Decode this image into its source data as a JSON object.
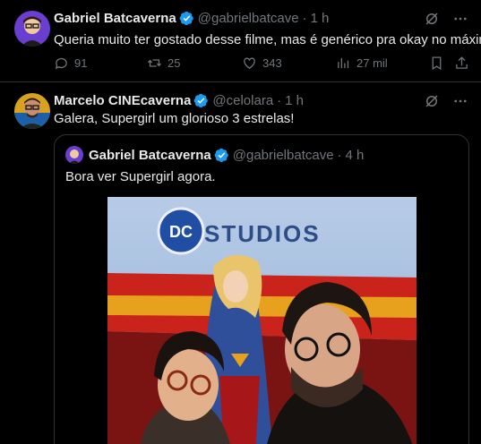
{
  "tweets": [
    {
      "author_name": "Gabriel Batcaverna",
      "author_handle": "@gabrielbatcave",
      "separator": "·",
      "time": "1 h",
      "text": "Queria muito ter gostado desse filme, mas é genérico pra okay no máximo.",
      "replies": "91",
      "reposts": "25",
      "likes": "343",
      "views": "27 mil"
    },
    {
      "author_name": "Marcelo CINEcaverna",
      "author_handle": "@celolara",
      "separator": "·",
      "time": "1 h",
      "text": "Galera, Supergirl um glorioso 3 estrelas!",
      "quoted": {
        "author_name": "Gabriel Batcaverna",
        "author_handle": "@gabrielbatcave",
        "separator": "·",
        "time": "4 h",
        "text": "Bora ver Supergirl agora.",
        "poster_text": "STUDIOS",
        "poster_logo": "DC"
      }
    }
  ],
  "colors": {
    "background": "#000000",
    "text": "#e7e9ea",
    "muted": "#71767b",
    "border": "#2f3336",
    "verified": "#1d9bf0"
  },
  "icons": [
    "grok-icon",
    "more-icon",
    "reply-icon",
    "repost-icon",
    "like-icon",
    "views-icon",
    "bookmark-icon",
    "share-icon",
    "verified-icon"
  ]
}
